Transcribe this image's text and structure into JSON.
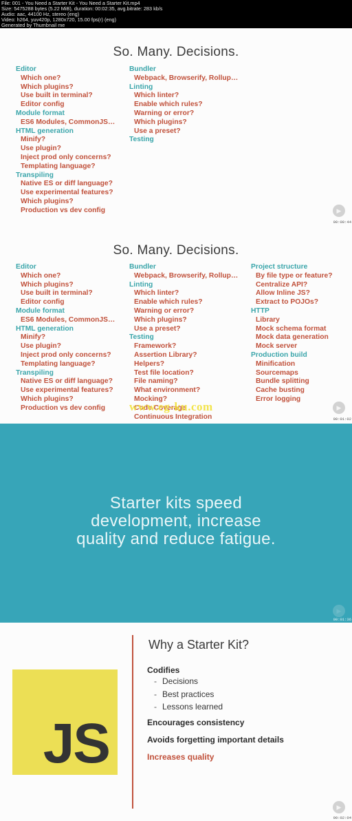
{
  "header": {
    "lines": [
      "File: 001 - You Need a Starter Kit - You Need a Starter Kit.mp4",
      "Size: 5475288 bytes (5.22 MiB), duration: 00:02:35, avg.bitrate: 283 kb/s",
      "Audio: aac, 44100 Hz, stereo (eng)",
      "Video: h264, yuv420p, 1280x720, 15.00 fps(r) (eng)",
      "Generated by Thumbnail me"
    ]
  },
  "frames": [
    {
      "title": "So. Many. Decisions.",
      "timestamp": "00:00:44",
      "columns": [
        [
          {
            "category": "Editor",
            "items": [
              "Which one?",
              "Which plugins?",
              "Use built in terminal?",
              "Editor config"
            ]
          },
          {
            "category": "Module format",
            "items": [
              "ES6 Modules, CommonJS…"
            ]
          },
          {
            "category": "HTML generation",
            "items": [
              "Minify?",
              "Use plugin?",
              "Inject prod only concerns?",
              "Templating language?"
            ]
          },
          {
            "category": "Transpiling",
            "items": [
              "Native ES or diff language?",
              "Use experimental features?",
              "Which plugins?",
              "Production vs dev config"
            ]
          }
        ],
        [
          {
            "category": "Bundler",
            "items": [
              "Webpack, Browserify, Rollup…"
            ]
          },
          {
            "category": "Linting",
            "items": [
              "Which linter?",
              "Enable which rules?",
              "Warning or error?",
              "Which plugins?",
              "Use a preset?"
            ]
          },
          {
            "category": "Testing",
            "items": []
          }
        ]
      ]
    },
    {
      "title": "So. Many. Decisions.",
      "timestamp": "00:01:02",
      "watermark": "www.eg-ku.com",
      "columns": [
        [
          {
            "category": "Editor",
            "items": [
              "Which one?",
              "Which plugins?",
              "Use built in terminal?",
              "Editor config"
            ]
          },
          {
            "category": "Module format",
            "items": [
              "ES6 Modules, CommonJS…"
            ]
          },
          {
            "category": "HTML generation",
            "items": [
              "Minify?",
              "Use plugin?",
              "Inject prod only concerns?",
              "Templating language?"
            ]
          },
          {
            "category": "Transpiling",
            "items": [
              "Native ES or diff language?",
              "Use experimental features?",
              "Which plugins?",
              "Production vs dev config"
            ]
          }
        ],
        [
          {
            "category": "Bundler",
            "items": [
              "Webpack, Browserify, Rollup…"
            ]
          },
          {
            "category": "Linting",
            "items": [
              "Which linter?",
              "Enable which rules?",
              "Warning or error?",
              "Which plugins?",
              "Use a preset?"
            ]
          },
          {
            "category": "Testing",
            "items": [
              "Framework?",
              "Assertion Library?",
              "Helpers?",
              "Test file location?",
              "File naming?",
              "What environment?",
              "Mocking?",
              "Code Coverage",
              "Continuous Integration"
            ]
          }
        ],
        [
          {
            "category": "Project structure",
            "items": [
              "By file type or feature?",
              "Centralize API?",
              "Allow Inline JS?",
              "Extract to POJOs?"
            ]
          },
          {
            "category": "HTTP",
            "items": [
              "Library",
              "Mock schema format",
              "Mock data generation",
              "Mock server"
            ]
          },
          {
            "category": "Production build",
            "items": [
              "Minification",
              "Sourcemaps",
              "Bundle splitting",
              "Cache busting",
              "Error logging"
            ]
          }
        ]
      ]
    },
    {
      "quote": [
        "Starter kits speed",
        "development, increase",
        "quality and reduce fatigue."
      ],
      "timestamp": "00:01:36"
    },
    {
      "title": "Why a Starter Kit?",
      "logo_text": "JS",
      "timestamp": "00:02:04",
      "codifies": "Codifies",
      "codifies_items": [
        "Decisions",
        "Best practices",
        "Lessons learned"
      ],
      "point2": "Encourages consistency",
      "point3": "Avoids forgetting important details",
      "point4": "Increases quality"
    }
  ],
  "colors": {
    "category": "#3aa5aa",
    "item": "#c0503a",
    "teal_bg": "#37a5b8",
    "js_yellow": "#ecdf55"
  }
}
